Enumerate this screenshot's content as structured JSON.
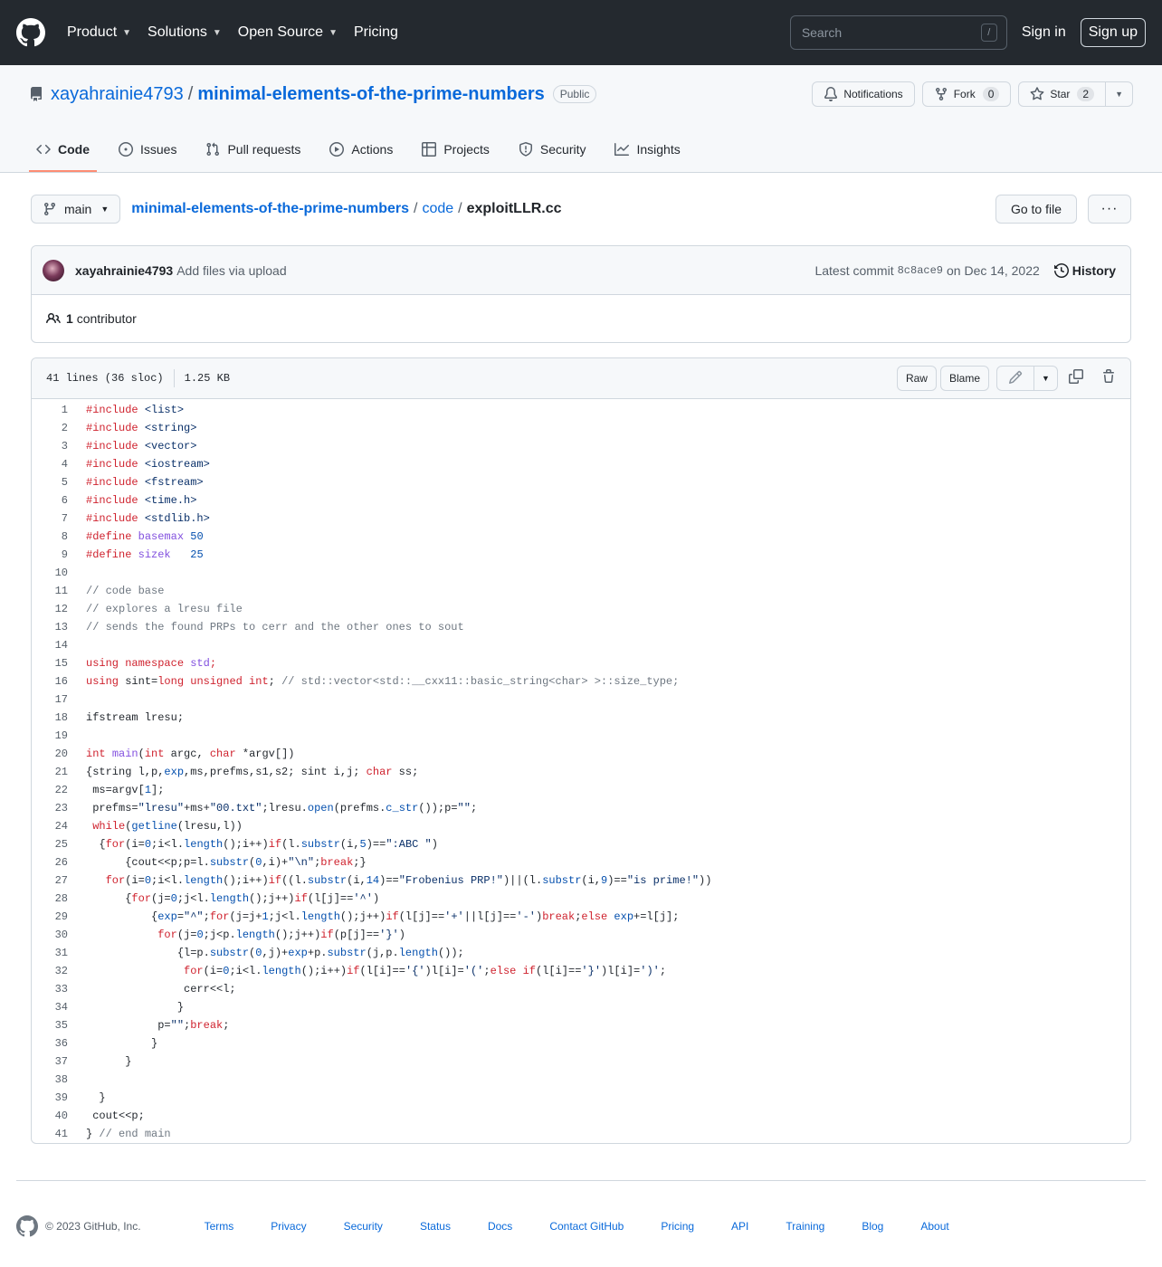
{
  "header": {
    "nav": [
      "Product",
      "Solutions",
      "Open Source",
      "Pricing"
    ],
    "search_placeholder": "Search",
    "search_shortcut": "/",
    "sign_in": "Sign in",
    "sign_up": "Sign up"
  },
  "repo": {
    "owner": "xayahrainie4793",
    "name": "minimal-elements-of-the-prime-numbers",
    "visibility": "Public",
    "notifications_label": "Notifications",
    "fork_label": "Fork",
    "fork_count": "0",
    "star_label": "Star",
    "star_count": "2",
    "tabs": [
      "Code",
      "Issues",
      "Pull requests",
      "Actions",
      "Projects",
      "Security",
      "Insights"
    ]
  },
  "file_nav": {
    "branch": "main",
    "crumb_repo": "minimal-elements-of-the-prime-numbers",
    "crumb_dir": "code",
    "crumb_file": "exploitLLR.cc",
    "goto_label": "Go to file"
  },
  "commit": {
    "author": "xayahrainie4793",
    "message": "Add files via upload",
    "latest_prefix": "Latest commit",
    "sha": "8c8ace9",
    "date": "on Dec 14, 2022",
    "history_label": "History",
    "contributors_count": "1",
    "contributors_label": "contributor"
  },
  "file": {
    "lines_info": "41 lines (36 sloc)",
    "size": "1.25 KB",
    "raw_label": "Raw",
    "blame_label": "Blame",
    "code_lines": [
      [
        [
          "k",
          "#include"
        ],
        [
          "t",
          " "
        ],
        [
          "s",
          "<list>"
        ]
      ],
      [
        [
          "k",
          "#include"
        ],
        [
          "t",
          " "
        ],
        [
          "s",
          "<string>"
        ]
      ],
      [
        [
          "k",
          "#include"
        ],
        [
          "t",
          " "
        ],
        [
          "s",
          "<vector>"
        ]
      ],
      [
        [
          "k",
          "#include"
        ],
        [
          "t",
          " "
        ],
        [
          "s",
          "<iostream>"
        ]
      ],
      [
        [
          "k",
          "#include"
        ],
        [
          "t",
          " "
        ],
        [
          "s",
          "<fstream>"
        ]
      ],
      [
        [
          "k",
          "#include"
        ],
        [
          "t",
          " "
        ],
        [
          "s",
          "<time.h>"
        ]
      ],
      [
        [
          "k",
          "#include"
        ],
        [
          "t",
          " "
        ],
        [
          "s",
          "<stdlib.h>"
        ]
      ],
      [
        [
          "k",
          "#define"
        ],
        [
          "t",
          " "
        ],
        [
          "f",
          "basemax"
        ],
        [
          "t",
          " "
        ],
        [
          "n",
          "50"
        ]
      ],
      [
        [
          "k",
          "#define"
        ],
        [
          "t",
          " "
        ],
        [
          "f",
          "sizek"
        ],
        [
          "t",
          "   "
        ],
        [
          "n",
          "25"
        ]
      ],
      [],
      [
        [
          "c",
          "// code base"
        ]
      ],
      [
        [
          "c",
          "// explores a lresu file"
        ]
      ],
      [
        [
          "c",
          "// sends the found PRPs to cerr and the other ones to sout"
        ]
      ],
      [],
      [
        [
          "k",
          "using namespace"
        ],
        [
          "t",
          " "
        ],
        [
          "f",
          "std"
        ],
        [
          "k",
          ";"
        ]
      ],
      [
        [
          "k",
          "using"
        ],
        [
          "t",
          " sint="
        ],
        [
          "k",
          "long unsigned int"
        ],
        [
          "t",
          "; "
        ],
        [
          "c",
          "// std::vector<std::__cxx11::basic_string<char> >::size_type;"
        ]
      ],
      [],
      [
        [
          "t",
          "ifstream lresu;"
        ]
      ],
      [],
      [
        [
          "k",
          "int"
        ],
        [
          "t",
          " "
        ],
        [
          "f",
          "main"
        ],
        [
          "t",
          "("
        ],
        [
          "k",
          "int"
        ],
        [
          "t",
          " argc, "
        ],
        [
          "k",
          "char"
        ],
        [
          "t",
          " *argv[])"
        ]
      ],
      [
        [
          "t",
          "{string l,p,"
        ],
        [
          "n",
          "exp"
        ],
        [
          "t",
          ",ms,prefms,s1,s2; sint i,j; "
        ],
        [
          "k",
          "char"
        ],
        [
          "t",
          " ss;"
        ]
      ],
      [
        [
          "t",
          " ms=argv["
        ],
        [
          "n",
          "1"
        ],
        [
          "t",
          "];"
        ]
      ],
      [
        [
          "t",
          " prefms="
        ],
        [
          "s",
          "\"lresu\""
        ],
        [
          "t",
          "+ms+"
        ],
        [
          "s",
          "\"00.txt\""
        ],
        [
          "t",
          ";lresu."
        ],
        [
          "n",
          "open"
        ],
        [
          "t",
          "(prefms."
        ],
        [
          "n",
          "c_str"
        ],
        [
          "t",
          "());p="
        ],
        [
          "s",
          "\"\""
        ],
        [
          "t",
          ";"
        ]
      ],
      [
        [
          "t",
          " "
        ],
        [
          "k",
          "while"
        ],
        [
          "t",
          "("
        ],
        [
          "n",
          "getline"
        ],
        [
          "t",
          "(lresu,l))"
        ]
      ],
      [
        [
          "t",
          "  {"
        ],
        [
          "k",
          "for"
        ],
        [
          "t",
          "(i="
        ],
        [
          "n",
          "0"
        ],
        [
          "t",
          ";i<l."
        ],
        [
          "n",
          "length"
        ],
        [
          "t",
          "();i++)"
        ],
        [
          "k",
          "if"
        ],
        [
          "t",
          "(l."
        ],
        [
          "n",
          "substr"
        ],
        [
          "t",
          "(i,"
        ],
        [
          "n",
          "5"
        ],
        [
          "t",
          ")=="
        ],
        [
          "s",
          "\":ABC \""
        ],
        [
          "t",
          ")"
        ]
      ],
      [
        [
          "t",
          "      {cout<<p;p=l."
        ],
        [
          "n",
          "substr"
        ],
        [
          "t",
          "("
        ],
        [
          "n",
          "0"
        ],
        [
          "t",
          ",i)+"
        ],
        [
          "s",
          "\"\\n\""
        ],
        [
          "t",
          ";"
        ],
        [
          "k",
          "break"
        ],
        [
          "t",
          ";}"
        ]
      ],
      [
        [
          "t",
          "   "
        ],
        [
          "k",
          "for"
        ],
        [
          "t",
          "(i="
        ],
        [
          "n",
          "0"
        ],
        [
          "t",
          ";i<l."
        ],
        [
          "n",
          "length"
        ],
        [
          "t",
          "();i++)"
        ],
        [
          "k",
          "if"
        ],
        [
          "t",
          "((l."
        ],
        [
          "n",
          "substr"
        ],
        [
          "t",
          "(i,"
        ],
        [
          "n",
          "14"
        ],
        [
          "t",
          ")=="
        ],
        [
          "s",
          "\"Frobenius PRP!\""
        ],
        [
          "t",
          ")||(l."
        ],
        [
          "n",
          "substr"
        ],
        [
          "t",
          "(i,"
        ],
        [
          "n",
          "9"
        ],
        [
          "t",
          ")=="
        ],
        [
          "s",
          "\"is prime!\""
        ],
        [
          "t",
          "))"
        ]
      ],
      [
        [
          "t",
          "      {"
        ],
        [
          "k",
          "for"
        ],
        [
          "t",
          "(j="
        ],
        [
          "n",
          "0"
        ],
        [
          "t",
          ";j<l."
        ],
        [
          "n",
          "length"
        ],
        [
          "t",
          "();j++)"
        ],
        [
          "k",
          "if"
        ],
        [
          "t",
          "(l[j]=="
        ],
        [
          "s",
          "'^'"
        ],
        [
          "t",
          ")"
        ]
      ],
      [
        [
          "t",
          "          {"
        ],
        [
          "n",
          "exp"
        ],
        [
          "t",
          "="
        ],
        [
          "s",
          "\"^\""
        ],
        [
          "t",
          ";"
        ],
        [
          "k",
          "for"
        ],
        [
          "t",
          "(j=j+"
        ],
        [
          "n",
          "1"
        ],
        [
          "t",
          ";j<l."
        ],
        [
          "n",
          "length"
        ],
        [
          "t",
          "();j++)"
        ],
        [
          "k",
          "if"
        ],
        [
          "t",
          "(l[j]=="
        ],
        [
          "s",
          "'+'"
        ],
        [
          "t",
          "||l[j]=="
        ],
        [
          "s",
          "'-'"
        ],
        [
          "t",
          ")"
        ],
        [
          "k",
          "break"
        ],
        [
          "t",
          ";"
        ],
        [
          "k",
          "else"
        ],
        [
          "t",
          " "
        ],
        [
          "n",
          "exp"
        ],
        [
          "t",
          "+=l[j];"
        ]
      ],
      [
        [
          "t",
          "           "
        ],
        [
          "k",
          "for"
        ],
        [
          "t",
          "(j="
        ],
        [
          "n",
          "0"
        ],
        [
          "t",
          ";j<p."
        ],
        [
          "n",
          "length"
        ],
        [
          "t",
          "();j++)"
        ],
        [
          "k",
          "if"
        ],
        [
          "t",
          "(p[j]=="
        ],
        [
          "s",
          "'}'"
        ],
        [
          "t",
          ")"
        ]
      ],
      [
        [
          "t",
          "              {l=p."
        ],
        [
          "n",
          "substr"
        ],
        [
          "t",
          "("
        ],
        [
          "n",
          "0"
        ],
        [
          "t",
          ",j)+"
        ],
        [
          "n",
          "exp"
        ],
        [
          "t",
          "+p."
        ],
        [
          "n",
          "substr"
        ],
        [
          "t",
          "(j,p."
        ],
        [
          "n",
          "length"
        ],
        [
          "t",
          "());"
        ]
      ],
      [
        [
          "t",
          "               "
        ],
        [
          "k",
          "for"
        ],
        [
          "t",
          "(i="
        ],
        [
          "n",
          "0"
        ],
        [
          "t",
          ";i<l."
        ],
        [
          "n",
          "length"
        ],
        [
          "t",
          "();i++)"
        ],
        [
          "k",
          "if"
        ],
        [
          "t",
          "(l[i]=="
        ],
        [
          "s",
          "'{'"
        ],
        [
          "t",
          ")l[i]="
        ],
        [
          "s",
          "'('"
        ],
        [
          "t",
          ";"
        ],
        [
          "k",
          "else if"
        ],
        [
          "t",
          "(l[i]=="
        ],
        [
          "s",
          "'}'"
        ],
        [
          "t",
          ")l[i]="
        ],
        [
          "s",
          "')'"
        ],
        [
          "t",
          ";"
        ]
      ],
      [
        [
          "t",
          "               cerr<<l;"
        ]
      ],
      [
        [
          "t",
          "              }"
        ]
      ],
      [
        [
          "t",
          "           p="
        ],
        [
          "s",
          "\"\""
        ],
        [
          "t",
          ";"
        ],
        [
          "k",
          "break"
        ],
        [
          "t",
          ";"
        ]
      ],
      [
        [
          "t",
          "          }"
        ]
      ],
      [
        [
          "t",
          "      }"
        ]
      ],
      [],
      [
        [
          "t",
          "  }"
        ]
      ],
      [
        [
          "t",
          " cout<<p;"
        ]
      ],
      [
        [
          "t",
          "} "
        ],
        [
          "c",
          "// end main"
        ]
      ]
    ]
  },
  "footer": {
    "copyright": "© 2023 GitHub, Inc.",
    "links": [
      "Terms",
      "Privacy",
      "Security",
      "Status",
      "Docs",
      "Contact GitHub",
      "Pricing",
      "API",
      "Training",
      "Blog",
      "About"
    ]
  }
}
